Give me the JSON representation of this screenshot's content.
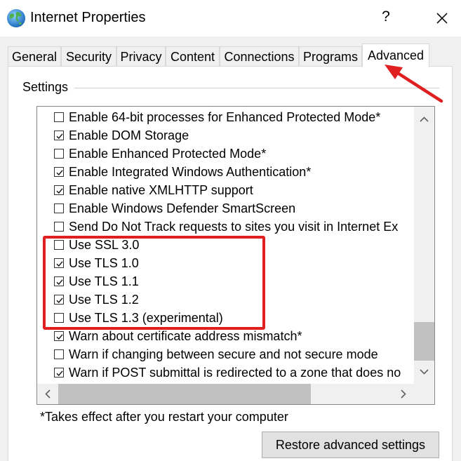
{
  "window": {
    "title": "Internet Properties",
    "help_label": "?",
    "app_icon": "globe-icon",
    "close_icon": "close-icon"
  },
  "tabs": [
    {
      "label": "General",
      "active": false
    },
    {
      "label": "Security",
      "active": false
    },
    {
      "label": "Privacy",
      "active": false
    },
    {
      "label": "Content",
      "active": false
    },
    {
      "label": "Connections",
      "active": false
    },
    {
      "label": "Programs",
      "active": false
    },
    {
      "label": "Advanced",
      "active": true
    }
  ],
  "settings": {
    "group_label": "Settings",
    "items": [
      {
        "label": "Enable 64-bit processes for Enhanced Protected Mode*",
        "checked": false
      },
      {
        "label": "Enable DOM Storage",
        "checked": true
      },
      {
        "label": "Enable Enhanced Protected Mode*",
        "checked": false
      },
      {
        "label": "Enable Integrated Windows Authentication*",
        "checked": true
      },
      {
        "label": "Enable native XMLHTTP support",
        "checked": true
      },
      {
        "label": "Enable Windows Defender SmartScreen",
        "checked": false
      },
      {
        "label": "Send Do Not Track requests to sites you visit in Internet Ex",
        "checked": false
      },
      {
        "label": "Use SSL 3.0",
        "checked": false
      },
      {
        "label": "Use TLS 1.0",
        "checked": true
      },
      {
        "label": "Use TLS 1.1",
        "checked": true
      },
      {
        "label": "Use TLS 1.2",
        "checked": true
      },
      {
        "label": "Use TLS 1.3 (experimental)",
        "checked": false
      },
      {
        "label": "Warn about certificate address mismatch*",
        "checked": true
      },
      {
        "label": "Warn if changing between secure and not secure mode",
        "checked": false
      },
      {
        "label": "Warn if POST submittal is redirected to a zone that does no",
        "checked": true
      }
    ]
  },
  "footer": {
    "note": "*Takes effect after you restart your computer",
    "restore_button": "Restore advanced settings"
  },
  "annotation": {
    "highlight_color": "#e02020"
  },
  "colors": {
    "dialog_bg": "#f0f0f0",
    "scroll_thumb": "#c1c1c1"
  }
}
